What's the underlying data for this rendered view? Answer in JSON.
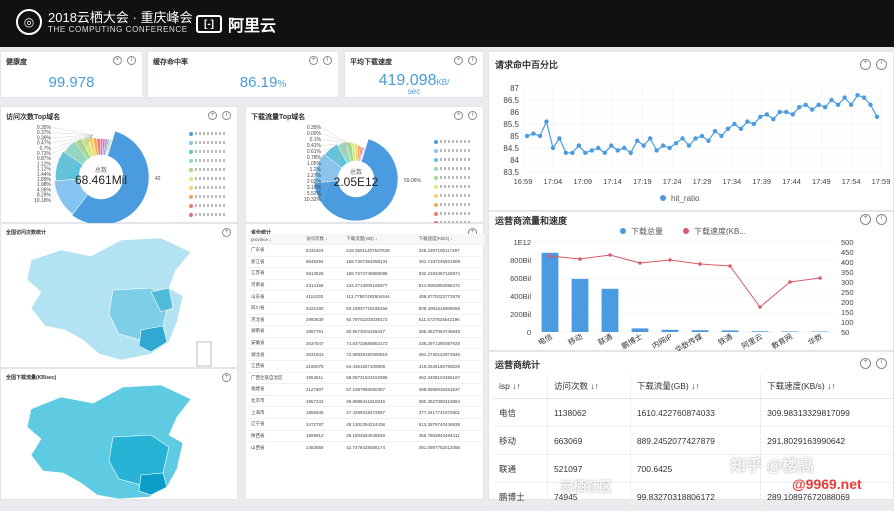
{
  "header": {
    "event_title": "2018云栖大会 · 重庆峰会",
    "event_subtitle": "THE COMPUTING CONFERENCE",
    "aliyun_label": "阿里云"
  },
  "kpis": [
    {
      "label": "健康度",
      "value": "99.978",
      "unit": ""
    },
    {
      "label": "缓存命中率",
      "value": "86.19",
      "unit": "%"
    },
    {
      "label": "平均下载速度",
      "value": "419.098",
      "unit": "KB/",
      "unit2": "sec"
    }
  ],
  "visits_donut": {
    "title": "访问次数Top域名",
    "center_label": "总数",
    "center_value": "68.461Mil",
    "slice_labels": [
      "0.35%",
      "0.37%",
      "0.39%",
      "0.47%",
      "0.7%",
      "0.73%",
      "0.87%",
      "1.12%",
      "1.12%",
      "1.44%",
      "1.89%",
      "1.98%",
      "4.06%",
      "8.29%",
      "10.18%",
      "42.39%"
    ],
    "colors": [
      "#4a9be0",
      "#86c5f2",
      "#5cc3dc",
      "#93d9c2",
      "#a5d88a",
      "#d7ea7e",
      "#f5d36a",
      "#f3a763",
      "#f07a6b",
      "#e8679b",
      "#c47ad1",
      "#9a8ae0",
      "#7c9ded",
      "#6fb6c7",
      "#9ccf82",
      "#c7d7b6"
    ],
    "values": [
      42.39,
      10.18,
      8.29,
      4.06,
      1.98,
      1.89,
      1.44,
      1.12,
      1.12,
      0.87,
      0.73,
      0.7,
      0.47,
      0.39,
      0.37,
      0.35
    ]
  },
  "download_donut": {
    "title": "下载流量Top域名",
    "center_label": "总数",
    "center_value": "2.05E12",
    "slice_labels": [
      "0.35%",
      "0.00%",
      "0.1%",
      "0.41%",
      "0.61%",
      "0.78%",
      "1.05%",
      "1.2%",
      "1.27%",
      "2.02%",
      "3.18%",
      "5.52%",
      "10.32%",
      "59.06%"
    ],
    "values": [
      59.06,
      10.32,
      5.52,
      3.18,
      2.02,
      1.27,
      1.2,
      1.05,
      0.78,
      0.61,
      0.41,
      0.1,
      0.0,
      0.35
    ]
  },
  "map1": {
    "title": "全国访问次数统计"
  },
  "map2": {
    "title": "全国下载流量(KB/sec)"
  },
  "province_table": {
    "title": "省份统计",
    "headers": [
      "province ↓",
      "访问次数 ↓",
      "下载流量(GB) ↓",
      "下载速度(KB/s) ↓"
    ],
    "rows": [
      [
        "广东省",
        "8431824",
        "218.36011407637628",
        "345.2397105117497"
      ],
      [
        "浙江省",
        "8648294",
        "169.7307364058134",
        "481.7187245921909"
      ],
      [
        "江苏省",
        "5813825",
        "158.7274749888088",
        "532.2183497126874"
      ],
      [
        "河南省",
        "4314169",
        "134.2713005165977",
        "814.8053893096472"
      ],
      [
        "山东省",
        "4116330",
        "113.77907492604344",
        "488.8770223771978"
      ],
      [
        "四川省",
        "3422180",
        "93.18937718195256",
        "509.4081516908658"
      ],
      [
        "河北省",
        "2993639",
        "92.79702203039173",
        "511.4737824642196"
      ],
      [
        "湖南省",
        "2957791",
        "80.9673003108437",
        "385.3527094745849"
      ],
      [
        "安徽省",
        "2537547",
        "74.83733688853173",
        "436.2971380087929"
      ],
      [
        "湖北省",
        "2631841",
        "72.08928160490818",
        "481.2730122974846"
      ],
      [
        "江西省",
        "2190075",
        "64.4361657109808",
        "419.2545160793029"
      ],
      [
        "广西壮族自治区",
        "1953611",
        "58.06731843152986",
        "462.3408103455187"
      ],
      [
        "福建省",
        "2127807",
        "57.2387993050387",
        "499.8989036261637"
      ],
      [
        "北京市",
        "1957343",
        "49.8988441810046",
        "380.3527080416894"
      ],
      [
        "上海市",
        "1866846",
        "47.4289318472697",
        "377.3417741972801"
      ],
      [
        "辽宁省",
        "1472787",
        "49.1302394224438",
        "513.3879740446939"
      ],
      [
        "陕西省",
        "1569812",
        "45.1504584048849",
        "456.7863843484411"
      ],
      [
        "山西省",
        "1483659",
        "42.7476425006174",
        "481.0997752012056"
      ]
    ]
  },
  "hit_ratio": {
    "title": "请求命中百分比",
    "icon_names": [
      "zoom-icon",
      "info-icon"
    ],
    "legend": "hit_ratio",
    "legend_color": "#4a9be0"
  },
  "chart_data": [
    {
      "type": "line",
      "title": "请求命中百分比",
      "x": [
        "16:59",
        "17:04",
        "17:09",
        "17:14",
        "17:19",
        "17:24",
        "17:29",
        "17:34",
        "17:39",
        "17:44",
        "17:49",
        "17:54",
        "17:59"
      ],
      "ylim": [
        83.5,
        87
      ],
      "y_ticks": [
        "83.5",
        "84",
        "84.5",
        "85",
        "85.5",
        "86",
        "86.5",
        "87"
      ],
      "series": [
        {
          "name": "hit_ratio",
          "values": [
            85.0,
            85.1,
            85.0,
            85.6,
            84.5,
            84.9,
            84.3,
            84.3,
            84.6,
            84.3,
            84.4,
            84.5,
            84.3,
            84.6,
            84.4,
            84.5,
            84.3,
            84.8,
            84.6,
            84.9,
            84.4,
            84.6,
            84.5,
            84.7,
            84.9,
            84.6,
            84.9,
            85.0,
            84.8,
            85.2,
            85.0,
            85.3,
            85.5,
            85.3,
            85.6,
            85.5,
            85.8,
            85.9,
            85.7,
            86.0,
            86.0,
            85.9,
            86.2,
            86.3,
            86.1,
            86.3,
            86.2,
            86.5,
            86.3,
            86.6,
            86.3,
            86.7,
            86.6,
            86.3,
            85.8
          ]
        }
      ],
      "grid": true,
      "legend": "bottom"
    },
    {
      "type": "bar",
      "title": "运营商流量和速度",
      "categories": [
        "电信",
        "移动",
        "联通",
        "鹏博士",
        "内网IP",
        "华数传媒",
        "铁通",
        "阿里云",
        "教育网",
        "华数"
      ],
      "left_ticks": [
        "1E12",
        "800Bil",
        "600Bil",
        "400Bil",
        "200Bil",
        "0"
      ],
      "right_ticks": [
        "500",
        "450",
        "400",
        "350",
        "300",
        "250",
        "200",
        "150",
        "100",
        "50"
      ],
      "left_ylim": [
        0,
        1000
      ],
      "right_ylim": [
        50,
        500
      ],
      "series": [
        {
          "name": "下载总量",
          "axis": "left",
          "unit": "Bil",
          "values": [
            880,
            590,
            480,
            40,
            25,
            20,
            18,
            8,
            6,
            5
          ]
        },
        {
          "name": "下载速度(KB...",
          "axis": "right",
          "values": [
            430,
            415,
            435,
            395,
            410,
            390,
            380,
            175,
            300,
            320
          ]
        }
      ],
      "legend": "top",
      "colors": [
        "#4a9be0",
        "#d95b6b"
      ]
    }
  ],
  "isp_chart": {
    "title": "运营商流量和速度",
    "legend": [
      "下载总量",
      "下载速度(KB..."
    ]
  },
  "isp_table": {
    "title": "运营商统计",
    "headers": [
      "isp ↓↑",
      "访问次数 ↓↑",
      "下载流量(GB) ↓↑",
      "下载速度(KB/s) ↓↑"
    ],
    "rows": [
      [
        "电信",
        "1138062",
        "1610.422760874033",
        "309.98313329817099"
      ],
      [
        "移动",
        "663069",
        "889.2452077427879",
        "291.8029163990642"
      ],
      [
        "联通",
        "521097",
        "700.6425",
        "-"
      ],
      [
        "鹏博士",
        "74945",
        "99.83270318806172",
        "289.10897672088069"
      ]
    ]
  },
  "watermarks": [
    "知乎 @楼高",
    "云栖社区",
    "@9969.net"
  ]
}
